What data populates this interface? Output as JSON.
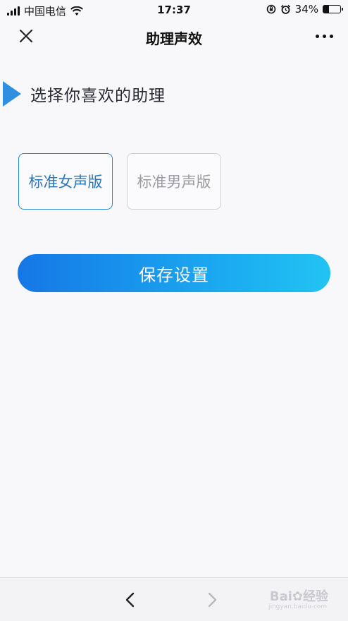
{
  "status_bar": {
    "carrier": "中国电信",
    "time": "17:37",
    "battery_percent": "34%",
    "battery_level": 0.34
  },
  "nav": {
    "title": "助理声效"
  },
  "section": {
    "title": "选择你喜欢的助理"
  },
  "options": [
    {
      "label": "标准女声版",
      "selected": true
    },
    {
      "label": "标准男声版",
      "selected": false
    }
  ],
  "save_button": {
    "label": "保存设置"
  },
  "colors": {
    "accent": "#2f8fe0",
    "button_gradient_start": "#1677e6",
    "button_gradient_end": "#22c3f3",
    "selected_border": "#2a86d6",
    "unselected_border": "#cfcfd3"
  },
  "watermark": {
    "brand": "Bai",
    "brand_suffix": "经验",
    "url": "jingyan.baidu.com"
  }
}
